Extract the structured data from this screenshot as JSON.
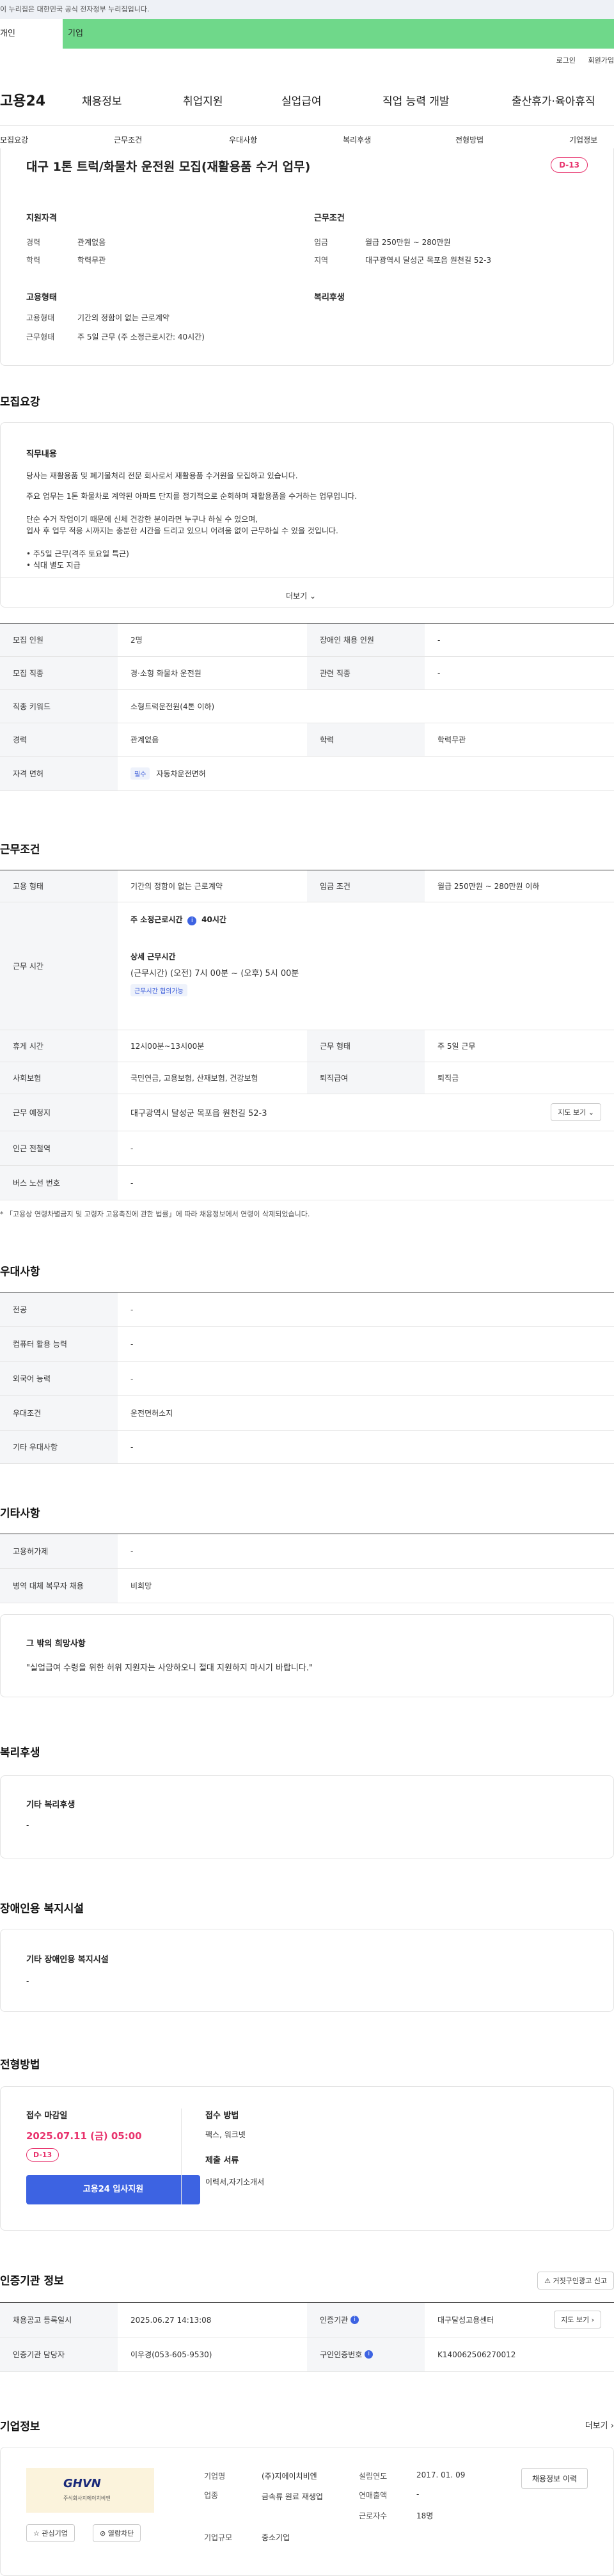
{
  "gov_banner": "이 누리집은 대한민국 공식 전자정부 누리집입니다.",
  "top_tabs": {
    "person": "개인",
    "company": "기업"
  },
  "util": {
    "login": "로그인",
    "join": "회원가입"
  },
  "logo": "고용24",
  "gnb": [
    "채용정보",
    "취업지원",
    "실업급여",
    "직업 능력 개발",
    "출산휴가·육아휴직"
  ],
  "section_tabs": [
    "모집요강",
    "근무조건",
    "우대사항",
    "복리후생",
    "전형방법",
    "기업정보"
  ],
  "job": {
    "title": "대구 1톤 트럭/화물차 운전원 모집(재활용품 수거 업무)",
    "dday": "D-13",
    "qual_heading": "지원자격",
    "career_label": "경력",
    "career_value": "관계없음",
    "edu_label": "학력",
    "edu_value": "학력무관",
    "work_heading": "근무조건",
    "wage_label": "임금",
    "wage_value": "월급 250만원 ~ 280만원",
    "region_label": "지역",
    "region_value": "대구광역시 달성군 목포읍 원천길 52-3",
    "emp_heading": "고용형태",
    "emp_type_label": "고용형태",
    "emp_type_value": "기간의 정함이 없는 근로계약",
    "work_form_label": "근무형태",
    "work_form_value": "주 5일 근무 (주 소정근로시간: 40시간)",
    "welfare_heading": "복리후생"
  },
  "recruit": {
    "heading": "모집요강",
    "duty_heading": "직무내용",
    "desc1": "당사는 재활용품 및 폐기물처리 전문 회사로서 재활용품 수거원을 모집하고 있습니다.",
    "desc2": "주요 업무는 1톤 화물차로 계약된 아파트 단지를 정기적으로 순회하며 재활용품을 수거하는 업무입니다.",
    "desc3": "단순 수거 작업이기 때문에 신체 건강한 분이라면 누구나 하실 수 있으며,",
    "desc4": "입사 후 업무 적응 시까지는 충분한 시간을 드리고 있으니 어려움 없이 근무하실 수 있을 것입니다.",
    "desc5": "• 주5일 근무(격주 토요일 특근)",
    "desc6": "• 식대 별도 지급",
    "more": "더보기",
    "rows": {
      "count_label": "모집 인원",
      "count_value": "2명",
      "disabled_label": "장애인 채용 인원",
      "disabled_value": "-",
      "job_label": "모집 직종",
      "job_value": "경·소형 화물차 운전원",
      "related_label": "관련 직종",
      "related_value": "-",
      "keyword_label": "직종 키워드",
      "keyword_value": "소형트럭운전원(4톤 이하)",
      "career_label": "경력",
      "career_value": "관계없음",
      "edu_label": "학력",
      "edu_value": "학력무관",
      "license_label": "자격 면허",
      "license_chip": "필수",
      "license_value": "자동차운전면허"
    }
  },
  "conditions": {
    "heading": "근무조건",
    "emp_label": "고용 형태",
    "emp_value": "기간의 정함이 없는 근로계약",
    "wage_label": "임금 조건",
    "wage_value": "월급 250만원 ~ 280만원 이하",
    "time_label": "근무 시간",
    "weekly_hours": "주 소정근로시간",
    "weekly_value": "40시간",
    "detail_heading": "상세 근무시간",
    "detail_value": "(근무시간) (오전) 7시 00분 ~ (오후) 5시 00분",
    "detail_chip": "근무시간 협의가능",
    "break_label": "휴게 시간",
    "break_value": "12시00분~13시00분",
    "form_label": "근무 형태",
    "form_value": "주 5일 근무",
    "insurance_label": "사회보험",
    "insurance_value": "국민연금, 고용보험, 산재보험, 건강보험",
    "severance_label": "퇴직급여",
    "severance_value": "퇴직금",
    "place_label": "근무 예정지",
    "place_value": "대구광역시 달성군 목포읍 원천길 52-3",
    "map_btn": "지도 보기",
    "station_label": "인근 전철역",
    "station_value": "-",
    "bus_label": "버스 노선 번호",
    "bus_value": "-",
    "note": "* 「고용상 연령차별금지 및 고령자 고용촉진에 관한 법률」에 따라 채용정보에서 연령이 삭제되었습니다."
  },
  "preferences": {
    "heading": "우대사항",
    "major_label": "전공",
    "major_value": "-",
    "computer_label": "컴퓨터 활용 능력",
    "computer_value": "-",
    "language_label": "외국어 능력",
    "language_value": "-",
    "cond_label": "우대조건",
    "cond_value": "운전면허소지",
    "other_label": "기타 우대사항",
    "other_value": "-"
  },
  "others": {
    "heading": "기타사항",
    "permit_label": "고용허가제",
    "permit_value": "-",
    "military_label": "병역 대체 복무자 채용",
    "military_value": "비희망",
    "wish_heading": "그 밖의 희망사항",
    "wish_value": "\"실업급여 수령을 위한 허위 지원자는 사양하오니 절대 지원하지 마시기 바랍니다.\""
  },
  "welfare": {
    "heading": "복리후생",
    "sub": "기타 복리후생",
    "value": "-"
  },
  "disability": {
    "heading": "장애인용 복지시설",
    "sub": "기타 장애인용 복지시설",
    "value": "-"
  },
  "process": {
    "heading": "전형방법",
    "deadline_label": "접수 마감일",
    "deadline_value": "2025.07.11 (금) 05:00",
    "dday": "D-13",
    "apply_btn": "고용24 입사지원",
    "method_label": "접수 방법",
    "method_value": "팩스, 워크넷",
    "docs_label": "제출 서류",
    "docs_value": "이력서,자기소개서"
  },
  "agency": {
    "heading": "인증기관 정보",
    "report_btn": "거짓구인광고 신고",
    "reg_label": "채용공고 등록일시",
    "reg_value": "2025.06.27 14:13:08",
    "org_label": "인증기관",
    "org_value": "대구달성고용센터",
    "map_btn": "지도 보기",
    "manager_label": "인증기관 담당자",
    "manager_value": "이우경(053-605-9530)",
    "id_label": "구인인증번호",
    "id_value": "K140062506270012"
  },
  "company": {
    "heading": "기업정보",
    "more": "더보기",
    "logo_text": "GHVN",
    "logo_sub": "주식회사지에이치비엔",
    "interest_btn": "관심기업",
    "block_btn": "열람차단",
    "name_label": "기업명",
    "name_value": "(주)지에이치비엔",
    "industry_label": "업종",
    "industry_value": "금속류 원료 재생업",
    "size_label": "기업규모",
    "size_value": "중소기업",
    "founded_label": "설립연도",
    "founded_value": "2017. 01. 09",
    "sales_label": "연매출액",
    "sales_value": "-",
    "employees_label": "근로자수",
    "employees_value": "18명",
    "history_btn": "채용정보 이력"
  },
  "colors": {
    "accent_green": "#6fd88a",
    "dday_pink": "#e8336d",
    "primary_blue": "#3d63e2"
  }
}
